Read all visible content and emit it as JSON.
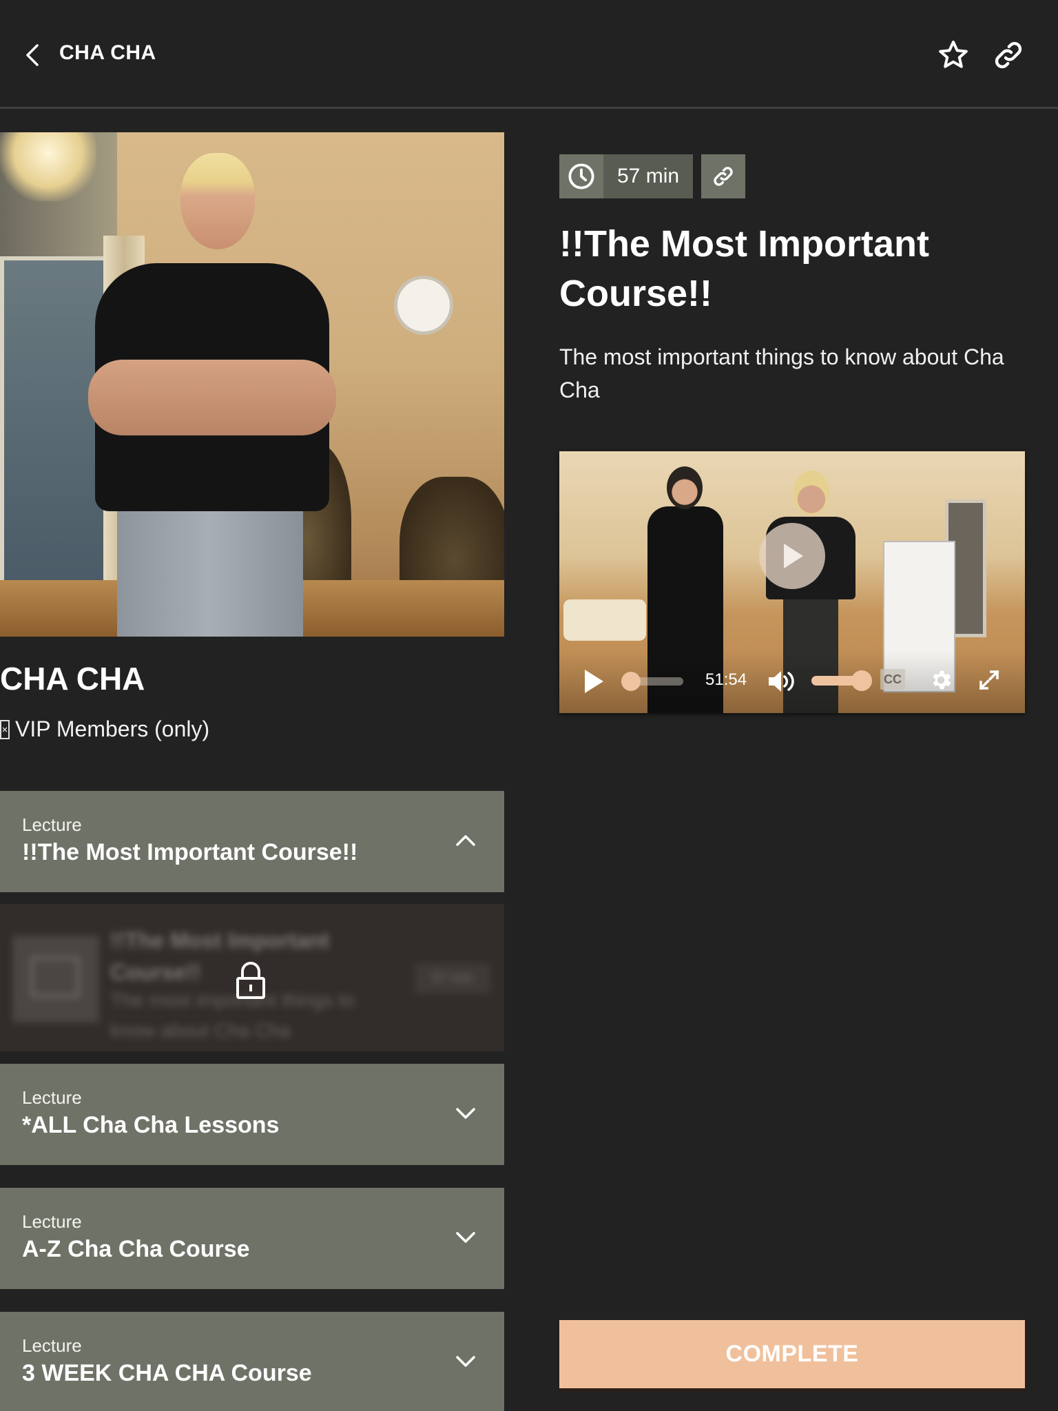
{
  "header": {
    "title": "CHA CHA",
    "back_icon": "chevron-left-icon",
    "actions": [
      {
        "name": "favorite",
        "icon": "star-outline-icon"
      },
      {
        "name": "share-link",
        "icon": "link-icon"
      }
    ]
  },
  "course": {
    "title": "CHA CHA",
    "access_glyph": "▯",
    "access_label": "VIP Members (only)",
    "hero_image": "instructor-standing-in-dance-studio"
  },
  "lectures": [
    {
      "type_label": "Lecture",
      "title": "!!The Most Important Course!!",
      "expanded": true,
      "items": [
        {
          "title": "!!The Most Important Course!!",
          "description": "The most important things to know about Cha Cha",
          "duration": "57 min",
          "locked": true,
          "icon": "book-icon"
        }
      ]
    },
    {
      "type_label": "Lecture",
      "title": "*ALL Cha Cha Lessons",
      "expanded": false
    },
    {
      "type_label": "Lecture",
      "title": "A-Z Cha Cha Course",
      "expanded": false
    },
    {
      "type_label": "Lecture",
      "title": "3 WEEK CHA CHA Course",
      "expanded": false
    }
  ],
  "lesson": {
    "duration": "57 min",
    "title": "!!The Most Important Course!!",
    "description": "The most important things to know about Cha Cha",
    "video": {
      "time_display": "51:54",
      "progress": 0.0,
      "volume": 1.0,
      "captions_label": "CC",
      "accent_color": "#f0c3a0"
    },
    "complete_label": "COMPLETE"
  },
  "colors": {
    "background": "#222222",
    "panel": "#6f7367",
    "accent": "#f0c09c"
  }
}
